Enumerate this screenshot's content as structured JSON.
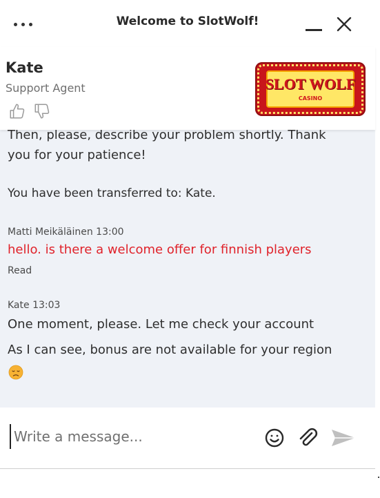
{
  "header": {
    "title": "Welcome to SlotWolf!",
    "menu_icon": "more-horizontal-icon",
    "minimize_icon": "minimize-icon",
    "close_icon": "close-icon"
  },
  "agent": {
    "name": "Kate",
    "role": "Support Agent",
    "rate_up_icon": "thumbs-up-icon",
    "rate_down_icon": "thumbs-down-icon"
  },
  "brand": {
    "logo_text": "SLOT WOLF",
    "logo_subtext": "CASINO",
    "logo_red": "#c8151b",
    "logo_yellow": "#ffe766"
  },
  "messages": {
    "line1": "Then, please, describe your problem shortly. Thank",
    "line2": "you for your patience!",
    "system_transfer": "You have been transferred to: Kate.",
    "user_meta": "Matti Meikäläinen 13:00",
    "user_text": "hello. is there a welcome offer for finnish players",
    "user_status": "Read",
    "agent_meta": "Kate 13:03",
    "agent_text1": "One moment, please. Let me check your account",
    "agent_text2": "As I can see, bonus are not available for your region",
    "emoji": "😞",
    "user_text_color": "#e0222a"
  },
  "composer": {
    "placeholder": "Write a message...",
    "value": "",
    "emoji_icon": "smiley-icon",
    "attach_icon": "paperclip-icon",
    "send_icon": "send-icon"
  },
  "colors": {
    "chat_background": "#eff2f7",
    "text": "#2e2e2e"
  }
}
